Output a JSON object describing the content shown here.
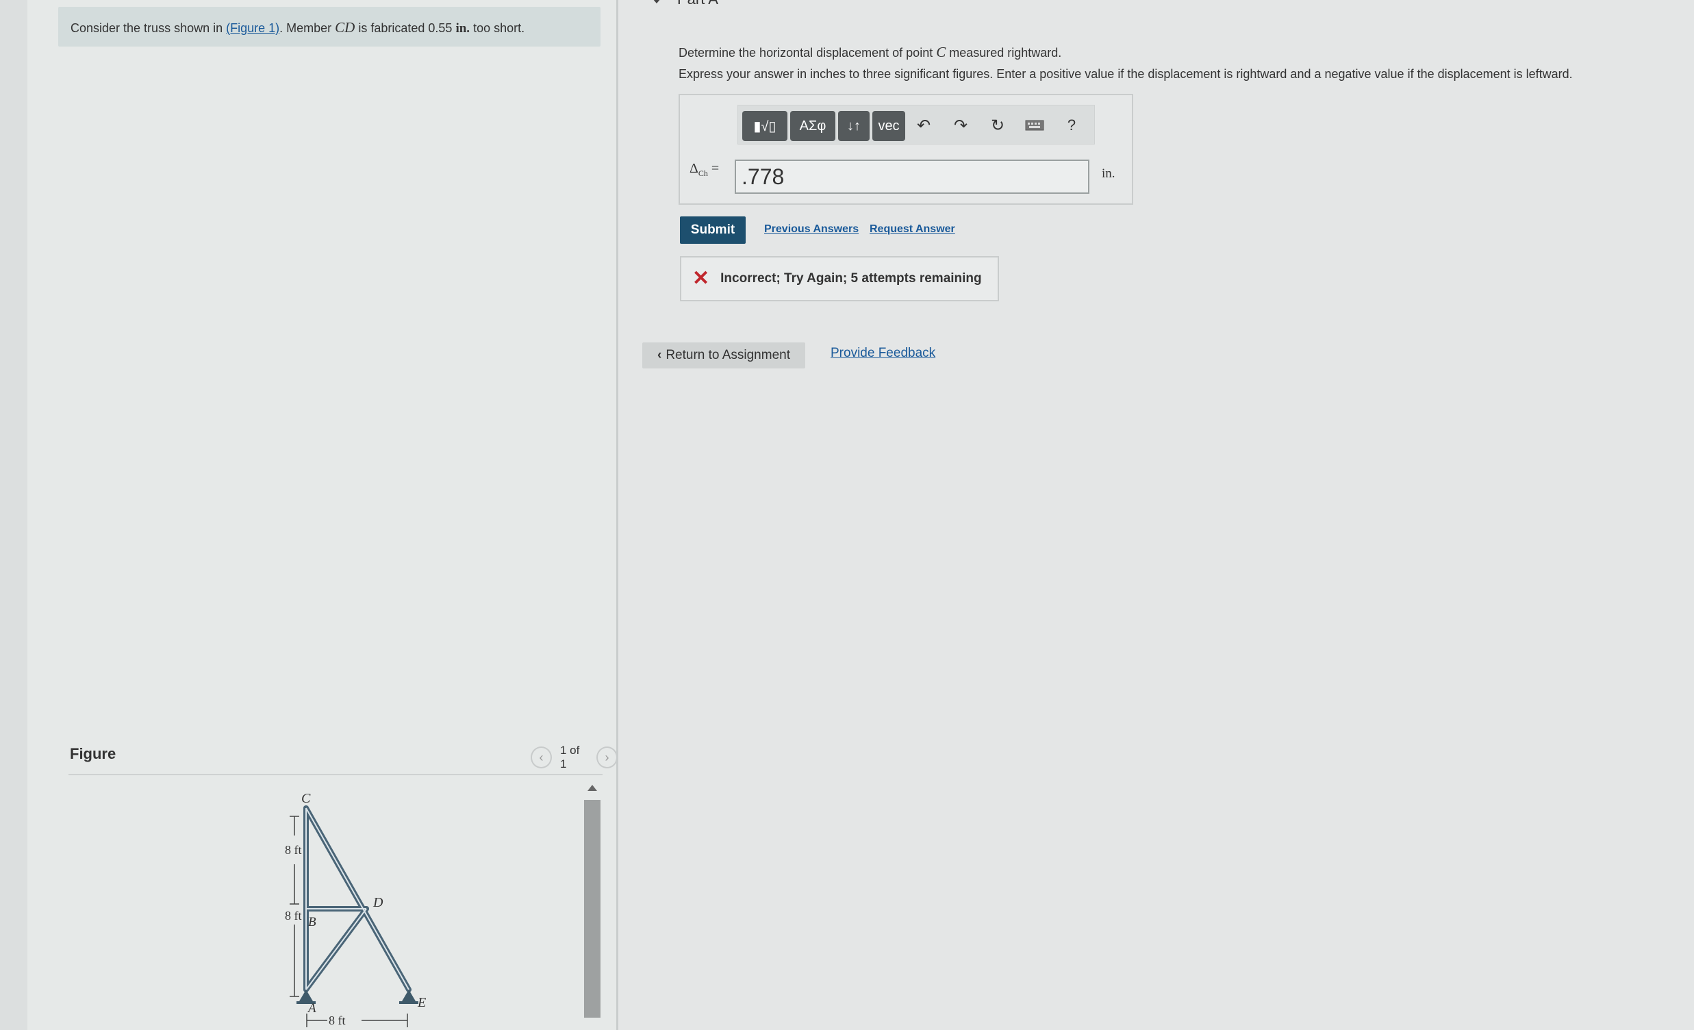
{
  "problem": {
    "text_before": "Consider the truss shown in ",
    "figure_link": "(Figure 1)",
    "text_mid": ". Member ",
    "member": "CD",
    "text_after": " is fabricated 0.55 ",
    "unit": "in.",
    "text_end": " too short."
  },
  "figure": {
    "label": "Figure",
    "pager": "1 of 1",
    "nodes": {
      "c": "C",
      "d": "D",
      "b": "B",
      "a": "A",
      "e": "E"
    },
    "dims": {
      "upper": "8 ft",
      "lower": "8 ft",
      "bottom": "8 ft"
    }
  },
  "part": {
    "title": "Part A"
  },
  "question": {
    "line1_before": "Determine the horizontal displacement of point ",
    "point": "C",
    "line1_after": " measured rightward.",
    "line2": "Express your answer in inches to three significant figures. Enter a positive value if the displacement is rightward and a negative value if the displacement is leftward."
  },
  "toolbar": {
    "templates": "▮√▯",
    "greek": "ΑΣφ",
    "arrows": "↓↑",
    "vec": "vec",
    "help": "?"
  },
  "answer": {
    "delta": "Δ",
    "sub": "C",
    "sub2": "h",
    "equals": "=",
    "value": ".778",
    "unit": "in."
  },
  "actions": {
    "submit": "Submit",
    "previous": "Previous Answers",
    "request": "Request Answer"
  },
  "feedback": {
    "message": "Incorrect; Try Again; 5 attempts remaining"
  },
  "nav": {
    "return": "Return to Assignment",
    "provide_feedback": "Provide Feedback"
  },
  "colors": {
    "submit_bg": "#1d4f6e",
    "link": "#1a5a9a",
    "error": "#c0272d",
    "truss_member": "#4a6577"
  }
}
